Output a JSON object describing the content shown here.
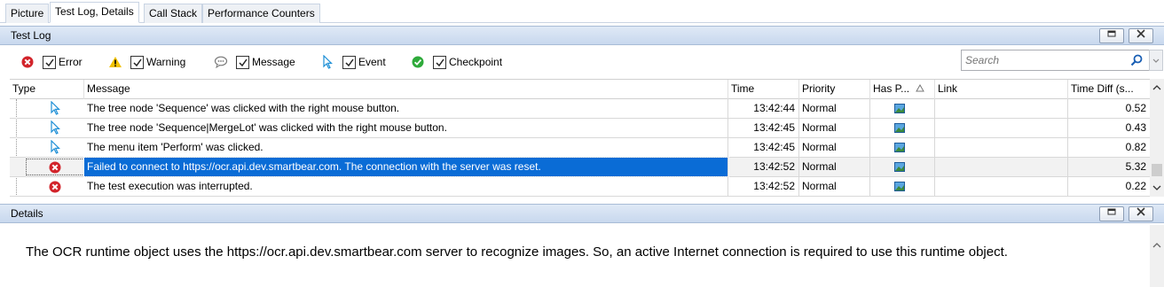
{
  "tabs": [
    {
      "label": "Picture"
    },
    {
      "label": "Test Log, Details"
    },
    {
      "label": "Call Stack"
    },
    {
      "label": "Performance Counters"
    }
  ],
  "test_log": {
    "title": "Test Log",
    "filters": [
      {
        "label": "Error",
        "checked": true,
        "icon": "error-icon"
      },
      {
        "label": "Warning",
        "checked": true,
        "icon": "warning-icon"
      },
      {
        "label": "Message",
        "checked": true,
        "icon": "message-icon"
      },
      {
        "label": "Event",
        "checked": true,
        "icon": "event-icon"
      },
      {
        "label": "Checkpoint",
        "checked": true,
        "icon": "checkpoint-icon"
      }
    ],
    "search": {
      "placeholder": "Search"
    },
    "columns": [
      "Type",
      "Message",
      "Time",
      "Priority",
      "Has P...",
      "Link",
      "Time Diff (s..."
    ],
    "rows": [
      {
        "type": "event",
        "message": "The tree node 'Sequence' was clicked with the right mouse button.",
        "time": "13:42:44",
        "priority": "Normal",
        "time_diff": "0.52",
        "selected": false
      },
      {
        "type": "event",
        "message": "The tree node 'Sequence|MergeLot' was clicked with the right mouse button.",
        "time": "13:42:45",
        "priority": "Normal",
        "time_diff": "0.43",
        "selected": false
      },
      {
        "type": "event",
        "message": "The menu item 'Perform' was clicked.",
        "time": "13:42:45",
        "priority": "Normal",
        "time_diff": "0.82",
        "selected": false
      },
      {
        "type": "error",
        "message": "Failed to connect to https://ocr.api.dev.smartbear.com. The connection with the server was reset.",
        "time": "13:42:52",
        "priority": "Normal",
        "time_diff": "5.32",
        "selected": true
      },
      {
        "type": "error",
        "message": "The test execution was interrupted.",
        "time": "13:42:52",
        "priority": "Normal",
        "time_diff": "0.22",
        "selected": false
      }
    ]
  },
  "details": {
    "title": "Details",
    "text": "The OCR runtime object uses the https://ocr.api.dev.smartbear.com server to recognize images. So, an active Internet connection is required to use this runtime object."
  },
  "colors": {
    "selection": "#0a6cd6",
    "error": "#d2232a",
    "event": "#1e8fd6",
    "checkpoint": "#2eaa3a",
    "warning": "#f2c200"
  }
}
